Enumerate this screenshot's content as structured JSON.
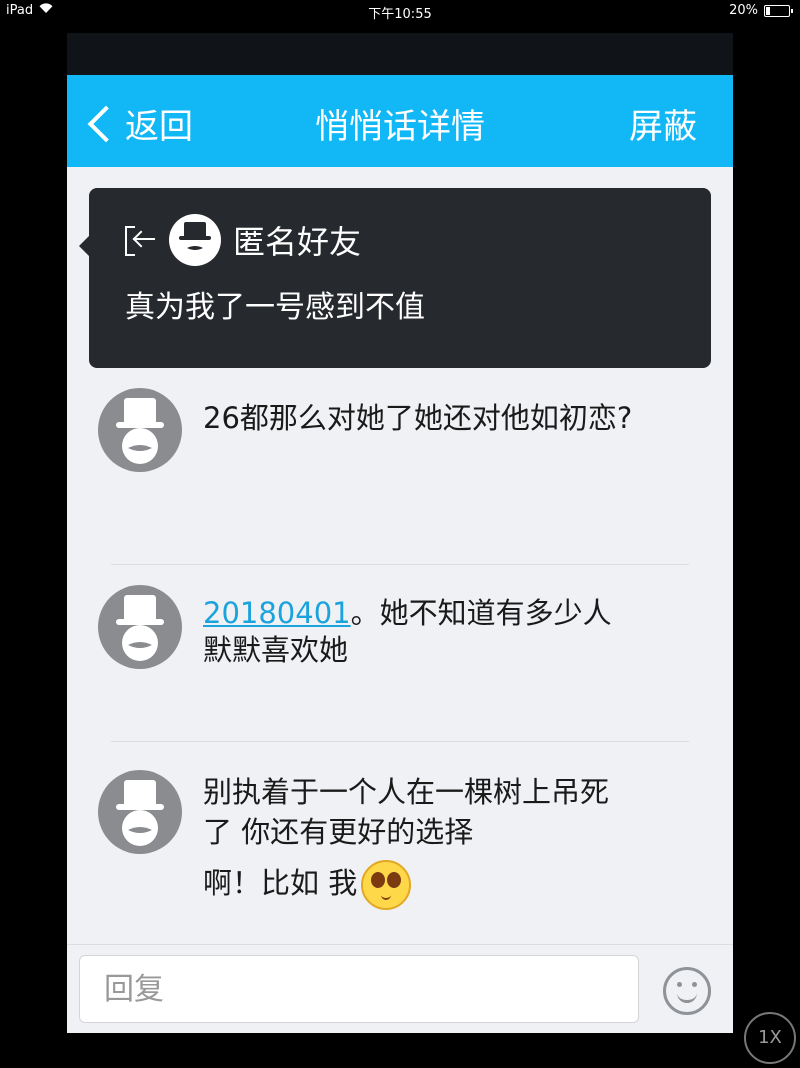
{
  "status_bar": {
    "device": "iPad",
    "time": "下午10:55",
    "battery": "20%",
    "battery_level": 0.2
  },
  "nav": {
    "back_label": "返回",
    "title": "悄悄话详情",
    "right_label": "屏蔽"
  },
  "popup": {
    "name": "匿名好友",
    "message": "真为我了一号感到不值"
  },
  "messages": [
    {
      "text": "26都那么对她了她还对他如初恋?"
    },
    {
      "link": "20180401",
      "text": "。她不知道有多少人默默喜欢她"
    },
    {
      "text": "别执着于一个人在一棵树上吊死了 你还有更好的选择",
      "text2": "啊！比如 我"
    }
  ],
  "input": {
    "placeholder": "回复"
  },
  "zoom": {
    "label": "1X"
  }
}
